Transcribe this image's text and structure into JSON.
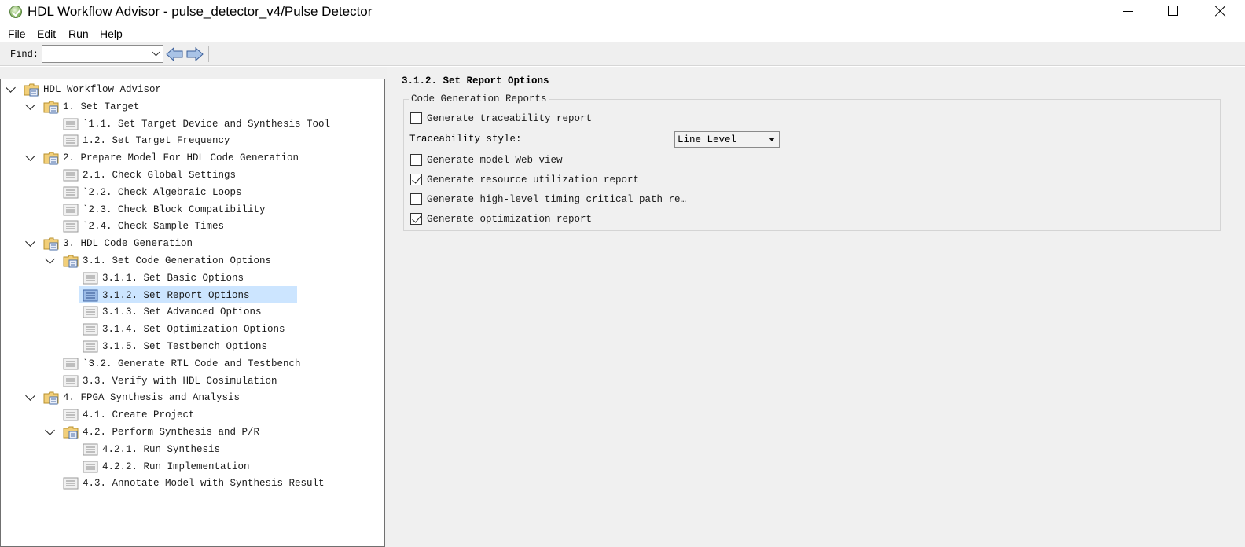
{
  "window": {
    "title": "HDL Workflow Advisor - pulse_detector_v4/Pulse Detector"
  },
  "menu": [
    "File",
    "Edit",
    "Run",
    "Help"
  ],
  "toolbar": {
    "find_label": "Find:",
    "find_value": ""
  },
  "tree": [
    {
      "label": "HDL Workflow Advisor",
      "icon": "folder-icon",
      "expanded": true
    },
    {
      "label": "1. Set Target",
      "icon": "folder-icon",
      "expanded": true
    },
    {
      "label": "`1.1. Set Target Device and Synthesis Tool",
      "icon": "task-icon"
    },
    {
      "label": "1.2. Set Target Frequency",
      "icon": "task-icon"
    },
    {
      "label": "2. Prepare Model For HDL Code Generation",
      "icon": "folder-icon",
      "expanded": true
    },
    {
      "label": "2.1. Check Global Settings",
      "icon": "task-icon"
    },
    {
      "label": "`2.2. Check Algebraic Loops",
      "icon": "task-icon"
    },
    {
      "label": "`2.3. Check Block Compatibility",
      "icon": "task-icon"
    },
    {
      "label": "`2.4. Check Sample Times",
      "icon": "task-icon"
    },
    {
      "label": "3. HDL Code Generation",
      "icon": "folder-icon",
      "expanded": true
    },
    {
      "label": "3.1. Set Code Generation Options",
      "icon": "folder-icon",
      "expanded": true
    },
    {
      "label": "3.1.1. Set Basic Options",
      "icon": "task-icon"
    },
    {
      "label": "3.1.2. Set Report Options",
      "icon": "task-icon",
      "selected": true
    },
    {
      "label": "3.1.3. Set Advanced Options",
      "icon": "task-icon"
    },
    {
      "label": "3.1.4. Set Optimization Options",
      "icon": "task-icon"
    },
    {
      "label": "3.1.5. Set Testbench Options",
      "icon": "task-icon"
    },
    {
      "label": "`3.2. Generate RTL Code and Testbench",
      "icon": "task-icon"
    },
    {
      "label": "3.3. Verify with HDL Cosimulation",
      "icon": "task-icon"
    },
    {
      "label": "4. FPGA Synthesis and Analysis",
      "icon": "folder-icon",
      "expanded": true
    },
    {
      "label": "4.1. Create Project",
      "icon": "task-icon"
    },
    {
      "label": "4.2. Perform Synthesis and P/R",
      "icon": "folder-icon",
      "expanded": true
    },
    {
      "label": "4.2.1. Run Synthesis",
      "icon": "task-icon"
    },
    {
      "label": "4.2.2. Run Implementation",
      "icon": "task-icon"
    },
    {
      "label": "4.3. Annotate Model with Synthesis Result",
      "icon": "task-icon"
    }
  ],
  "panel": {
    "title": "3.1.2. Set Report Options",
    "group_title": "Code Generation Reports",
    "traceability": {
      "label": "Traceability style:",
      "value": "Line Level"
    },
    "options": [
      {
        "label": "Generate traceability report",
        "checked": false
      },
      {
        "label": "Generate model Web view",
        "checked": false
      },
      {
        "label": "Generate resource utilization report",
        "checked": true
      },
      {
        "label": "Generate high-level timing critical path re…",
        "checked": false
      },
      {
        "label": "Generate optimization report",
        "checked": true
      }
    ]
  }
}
